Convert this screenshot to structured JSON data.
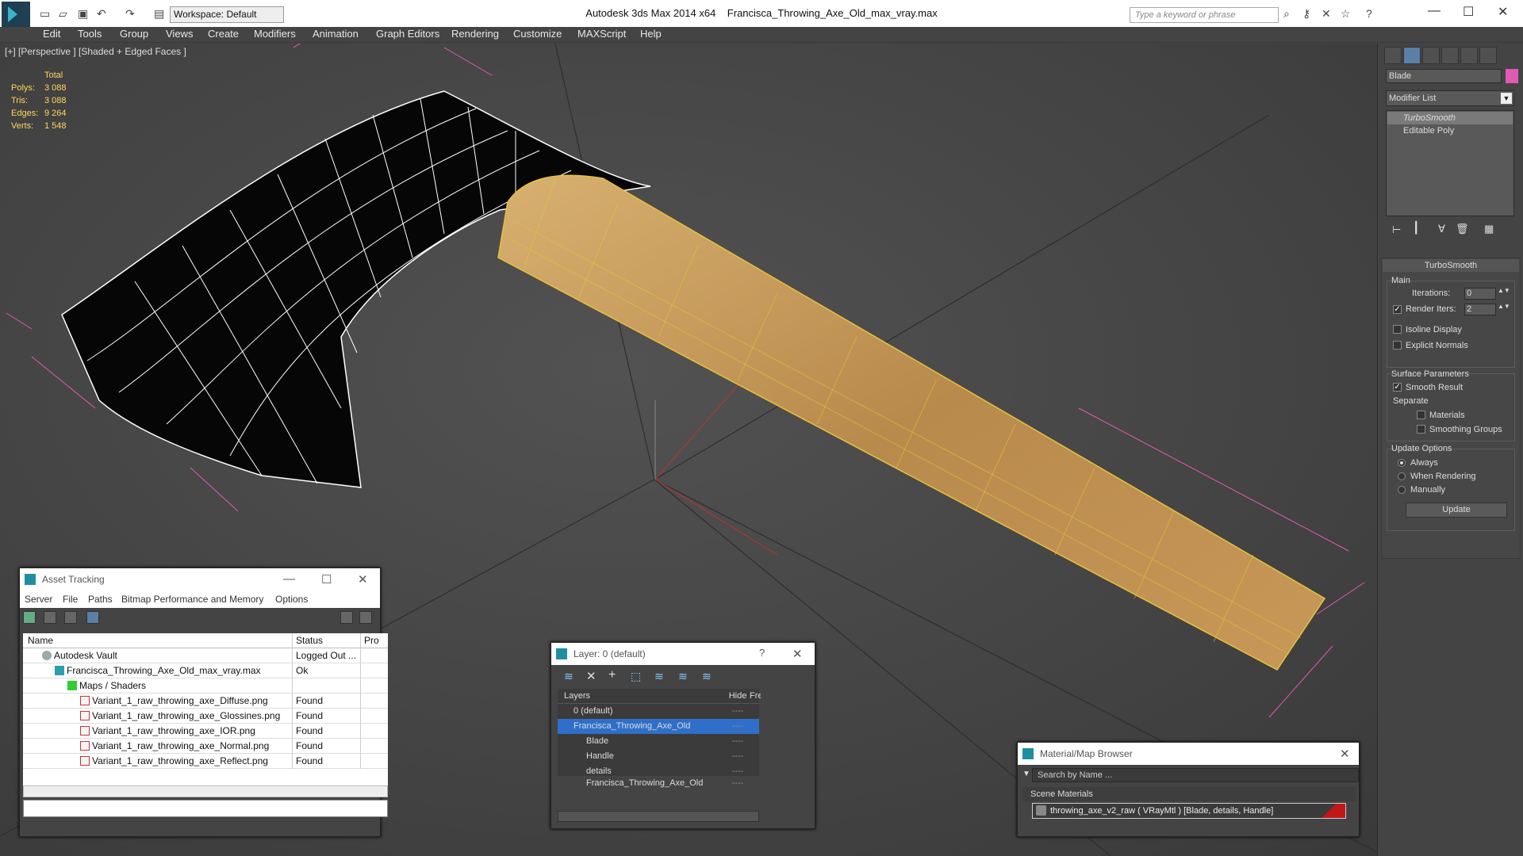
{
  "titlebar": {
    "workspace": "Workspace: Default",
    "app_title": "Autodesk 3ds Max  2014 x64",
    "file_title": "Francisca_Throwing_Axe_Old_max_vray.max",
    "search_placeholder": "Type a keyword or phrase"
  },
  "menu": [
    "Edit",
    "Tools",
    "Group",
    "Views",
    "Create",
    "Modifiers",
    "Animation",
    "Graph Editors",
    "Rendering",
    "Customize",
    "MAXScript",
    "Help"
  ],
  "viewport": {
    "label": "[+] [Perspective ] [Shaded + Edged Faces ]",
    "stats": {
      "total_label": "Total",
      "polys_label": "Polys:",
      "polys": "3 088",
      "tris_label": "Tris:",
      "tris": "3 088",
      "edges_label": "Edges:",
      "edges": "9 264",
      "verts_label": "Verts:",
      "verts": "1 548"
    }
  },
  "command_panel": {
    "object_name": "Blade",
    "object_color": "#e05ab4",
    "modifier_list": "Modifier List",
    "stack": [
      "TurboSmooth",
      "Editable Poly"
    ],
    "turbosmooth": {
      "title": "TurboSmooth",
      "main": "Main",
      "iterations_label": "Iterations:",
      "iterations": "0",
      "render_iters_label": "Render Iters:",
      "render_iters": "2",
      "isoline": "Isoline Display",
      "explicit_normals": "Explicit Normals",
      "surface_params": "Surface Parameters",
      "smooth_result": "Smooth Result",
      "separate": "Separate",
      "materials": "Materials",
      "smoothing_groups": "Smoothing Groups",
      "update_options": "Update Options",
      "always": "Always",
      "when_rendering": "When Rendering",
      "manually": "Manually",
      "update": "Update"
    }
  },
  "asset_tracking": {
    "title": "Asset Tracking",
    "menu": [
      "Server",
      "File",
      "Paths",
      "Bitmap Performance and Memory",
      "Options"
    ],
    "columns": [
      "Name",
      "Status",
      "Pro"
    ],
    "rows": [
      {
        "name": "Autodesk Vault",
        "status": "Logged Out ...",
        "icon": "vault-icon"
      },
      {
        "name": "Francisca_Throwing_Axe_Old_max_vray.max",
        "status": "Ok",
        "icon": "max-file-icon"
      },
      {
        "name": "Maps / Shaders",
        "status": "",
        "icon": "maps-icon"
      },
      {
        "name": "Variant_1_raw_throwing_axe_Diffuse.png",
        "status": "Found",
        "icon": "png-icon"
      },
      {
        "name": "Variant_1_raw_throwing_axe_Glossines.png",
        "status": "Found",
        "icon": "png-icon"
      },
      {
        "name": "Variant_1_raw_throwing_axe_IOR.png",
        "status": "Found",
        "icon": "png-icon"
      },
      {
        "name": "Variant_1_raw_throwing_axe_Normal.png",
        "status": "Found",
        "icon": "png-icon"
      },
      {
        "name": "Variant_1_raw_throwing_axe_Reflect.png",
        "status": "Found",
        "icon": "png-icon"
      }
    ]
  },
  "layer_window": {
    "title": "Layer: 0 (default)",
    "help": "?",
    "columns": [
      "Layers",
      "Hide",
      "Freeze"
    ],
    "rows": [
      {
        "name": "0 (default)"
      },
      {
        "name": "Francisca_Throwing_Axe_Old"
      },
      {
        "name": "Blade"
      },
      {
        "name": "Handle"
      },
      {
        "name": "details"
      },
      {
        "name": "Francisca_Throwing_Axe_Old"
      }
    ],
    "dash": "----"
  },
  "material_browser": {
    "title": "Material/Map Browser",
    "search_placeholder": "Search by Name ...",
    "section": "Scene Materials",
    "item": "throwing_axe_v2_raw  ( VRayMtl )  [Blade, details, Handle]"
  }
}
